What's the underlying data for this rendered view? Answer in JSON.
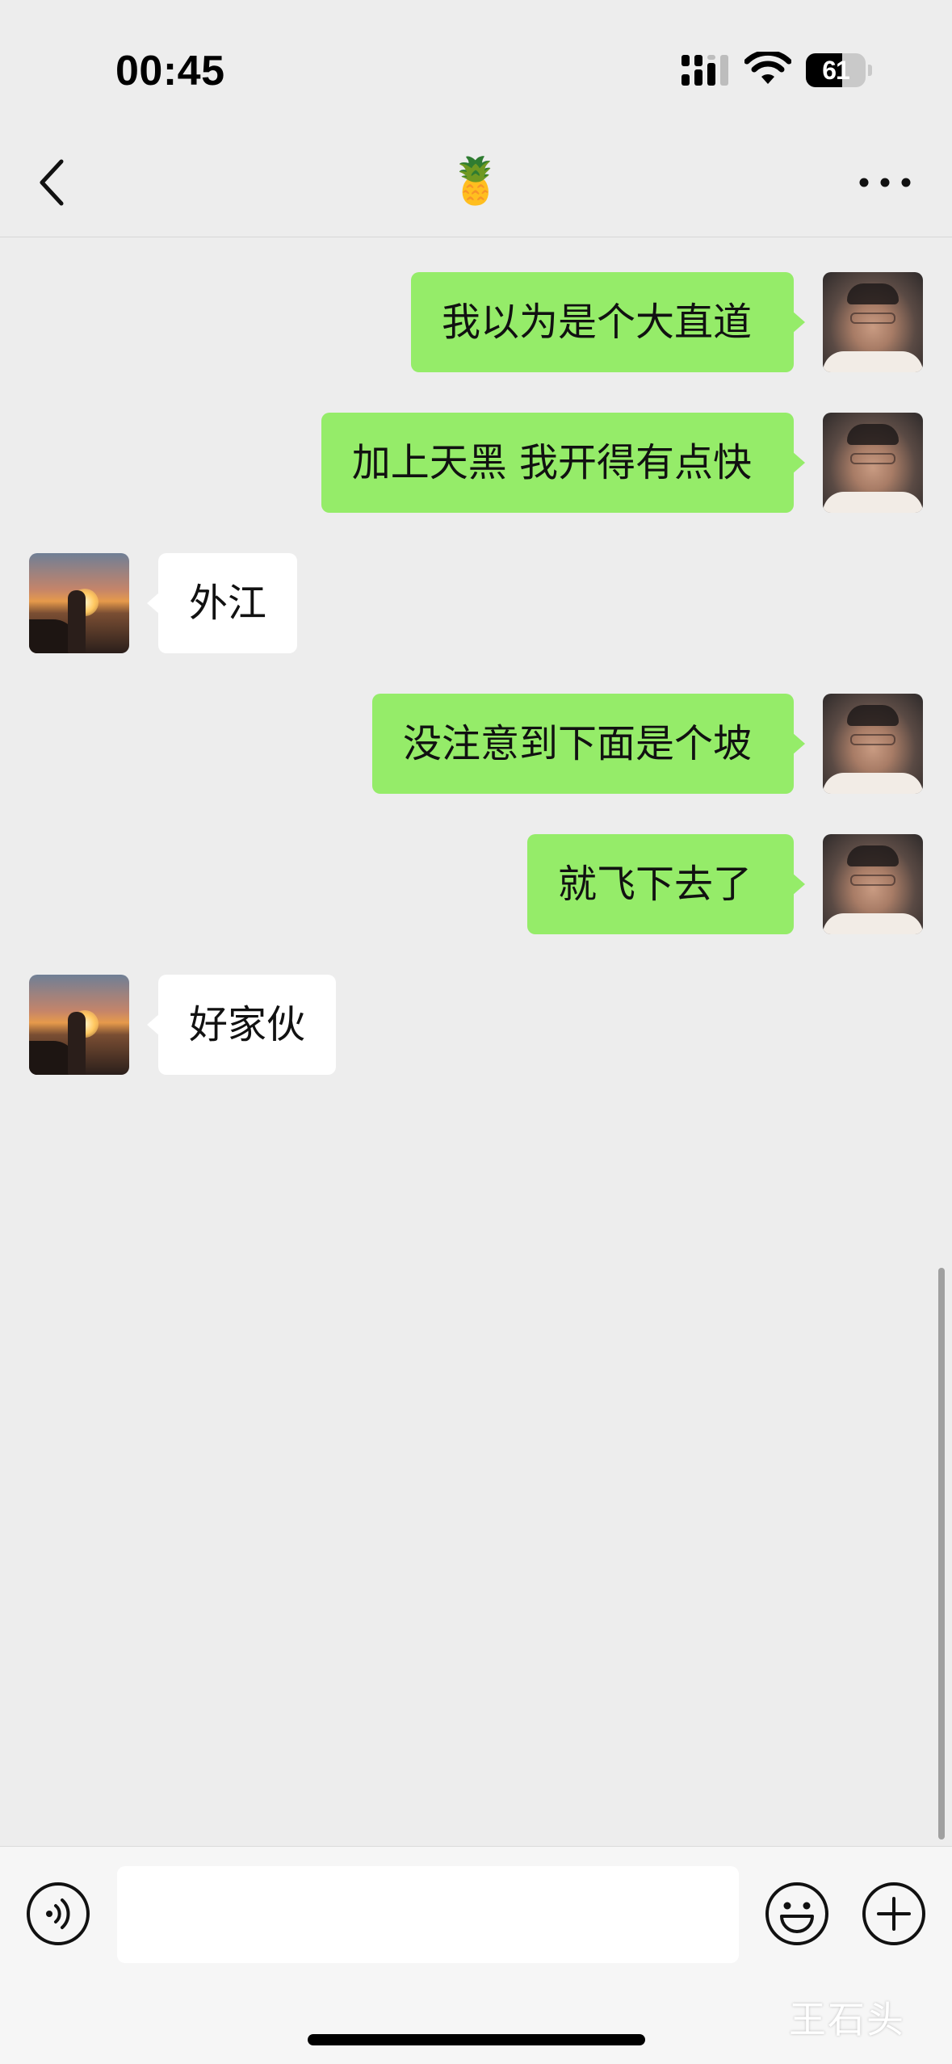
{
  "status_bar": {
    "time": "00:45",
    "battery_level": "61",
    "battery_fraction": 0.61,
    "icons": [
      "signal-icon",
      "wifi-icon",
      "battery-icon"
    ]
  },
  "nav": {
    "title": "🍍",
    "back_icon": "chevron-left-icon",
    "more_icon": "more-dots-icon"
  },
  "messages": [
    {
      "from": "self",
      "text": "我以为是个大直道"
    },
    {
      "from": "self",
      "text": "加上天黑 我开得有点快"
    },
    {
      "from": "other",
      "text": "外江"
    },
    {
      "from": "self",
      "text": "没注意到下面是个坡"
    },
    {
      "from": "self",
      "text": "就飞下去了"
    },
    {
      "from": "other",
      "text": "好家伙"
    }
  ],
  "input_bar": {
    "input_value": "",
    "icons": [
      "voice-icon",
      "emoji-icon",
      "plus-icon"
    ]
  },
  "watermark": "王石头",
  "colors": {
    "background": "#ededed",
    "sent_bubble": "#95ec69",
    "received_bubble": "#ffffff"
  }
}
